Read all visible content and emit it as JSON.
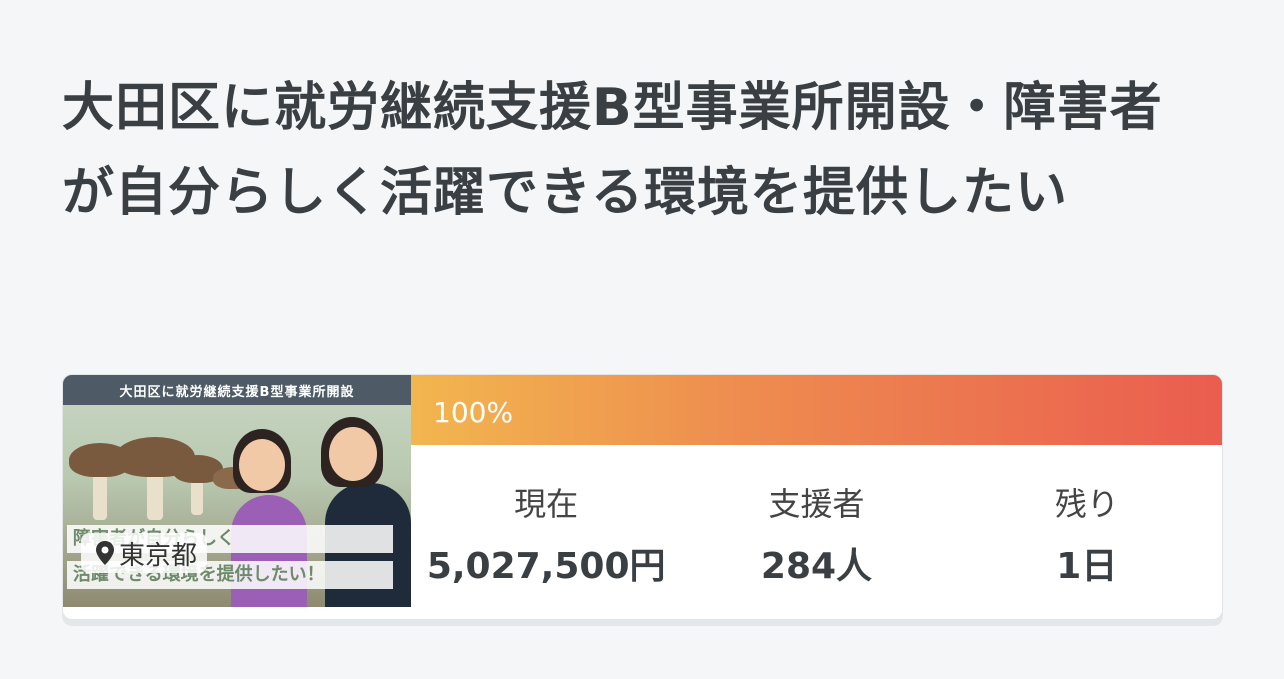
{
  "project": {
    "title": "大田区に就労継続支援B型事業所開設・障害者が自分らしく活躍できる環境を提供したい",
    "location": "東京都",
    "thumbnail": {
      "banner": "大田区に就労継続支援B型事業所開設",
      "caption_line1": "障害者が自分らしく",
      "caption_line2": "活躍できる環境を提供したい！"
    },
    "progress": {
      "percent_label": "100%",
      "percent": 100
    },
    "stats": [
      {
        "label": "現在",
        "value": "5,027,500円"
      },
      {
        "label": "支援者",
        "value": "284人"
      },
      {
        "label": "残り",
        "value": "1日"
      }
    ]
  },
  "colors": {
    "progress_start": "#f2b64f",
    "progress_end": "#ea5d4f",
    "page_bg": "#f4f6f8"
  },
  "icons": {
    "location": "map-pin-icon"
  }
}
